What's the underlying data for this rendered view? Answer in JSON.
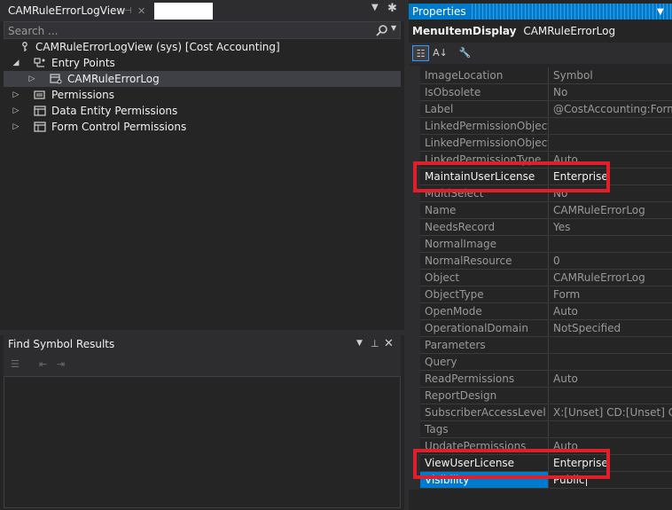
{
  "designer": {
    "tab_label": "CAMRuleErrorLogView",
    "search_placeholder": "Search ...",
    "tree": [
      {
        "label": "CAMRuleErrorLogView (sys) [Cost Accounting]",
        "icon": "key-icon"
      },
      {
        "label": "Entry Points",
        "icon": "entry-points-icon"
      },
      {
        "label": "CAMRuleErrorLog",
        "icon": "menu-item-icon"
      },
      {
        "label": "Permissions",
        "icon": "permissions-icon"
      },
      {
        "label": "Data Entity Permissions",
        "icon": "grid-icon"
      },
      {
        "label": "Form Control Permissions",
        "icon": "grid-icon"
      }
    ]
  },
  "find_symbol": {
    "title": "Find Symbol Results"
  },
  "properties": {
    "title": "Properties",
    "object_type": "MenuItemDisplay",
    "object_name": "CAMRuleErrorLog",
    "rows": [
      {
        "name": "ImageLocation",
        "value": "Symbol"
      },
      {
        "name": "IsObsolete",
        "value": "No"
      },
      {
        "name": "Label",
        "value": "@CostAccounting:Form_"
      },
      {
        "name": "LinkedPermissionObject",
        "value": ""
      },
      {
        "name": "LinkedPermissionObjectCh",
        "value": ""
      },
      {
        "name": "LinkedPermissionType",
        "value": "Auto"
      },
      {
        "name": "MaintainUserLicense",
        "value": "Enterprise"
      },
      {
        "name": "MultiSelect",
        "value": "No"
      },
      {
        "name": "Name",
        "value": "CAMRuleErrorLog"
      },
      {
        "name": "NeedsRecord",
        "value": "Yes"
      },
      {
        "name": "NormalImage",
        "value": ""
      },
      {
        "name": "NormalResource",
        "value": "0"
      },
      {
        "name": "Object",
        "value": "CAMRuleErrorLog"
      },
      {
        "name": "ObjectType",
        "value": "Form"
      },
      {
        "name": "OpenMode",
        "value": "Auto"
      },
      {
        "name": "OperationalDomain",
        "value": "NotSpecified"
      },
      {
        "name": "Parameters",
        "value": ""
      },
      {
        "name": "Query",
        "value": ""
      },
      {
        "name": "ReadPermissions",
        "value": "Auto"
      },
      {
        "name": "ReportDesign",
        "value": ""
      },
      {
        "name": "SubscriberAccessLevel",
        "value": "X:[Unset] CD:[Unset] C:[U"
      },
      {
        "name": "Tags",
        "value": ""
      },
      {
        "name": "UpdatePermissions",
        "value": "Auto"
      },
      {
        "name": "ViewUserLicense",
        "value": "Enterprise"
      },
      {
        "name": "Visibility",
        "value": "Public"
      }
    ]
  },
  "colors": {
    "accent": "#007acc",
    "highlight": "#e01f2b",
    "background": "#252526"
  }
}
